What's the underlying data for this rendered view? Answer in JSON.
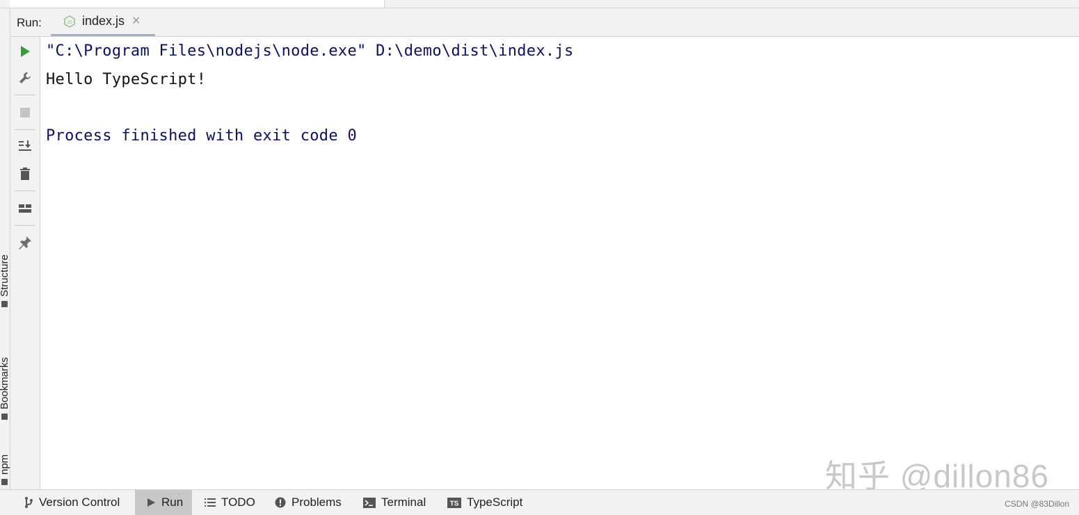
{
  "side_tabs": {
    "structure": "Structure",
    "bookmarks": "Bookmarks",
    "npm": "npm"
  },
  "run_panel": {
    "label": "Run:",
    "tab": {
      "label": "index.js",
      "icon": "nodejs-icon",
      "close_glyph": "✕"
    }
  },
  "toolbar": {
    "buttons": [
      "rerun-icon",
      "wrench-icon",
      "stop-icon",
      "scroll-to-end-icon",
      "trash-icon",
      "layout-icon",
      "pin-icon"
    ]
  },
  "console": {
    "lines": [
      "\"C:\\Program Files\\nodejs\\node.exe\" D:\\demo\\dist\\index.js",
      "Hello TypeScript!",
      "",
      "Process finished with exit code 0"
    ]
  },
  "watermark": "知乎 @dillon86",
  "bottom_bar": {
    "items": [
      {
        "label": "Version Control",
        "icon": "branch-icon",
        "active": false
      },
      {
        "label": "Run",
        "icon": "run-icon",
        "active": true
      },
      {
        "label": "TODO",
        "icon": "list-icon",
        "active": false
      },
      {
        "label": "Problems",
        "icon": "alert-icon",
        "active": false
      },
      {
        "label": "Terminal",
        "icon": "terminal-icon",
        "active": false
      },
      {
        "label": "TypeScript",
        "icon": "ts-icon",
        "active": false
      }
    ],
    "credit": "CSDN @83Dillon"
  },
  "colors": {
    "run_green": "#3d9a3f",
    "console_blue": "#0a0f6e"
  }
}
